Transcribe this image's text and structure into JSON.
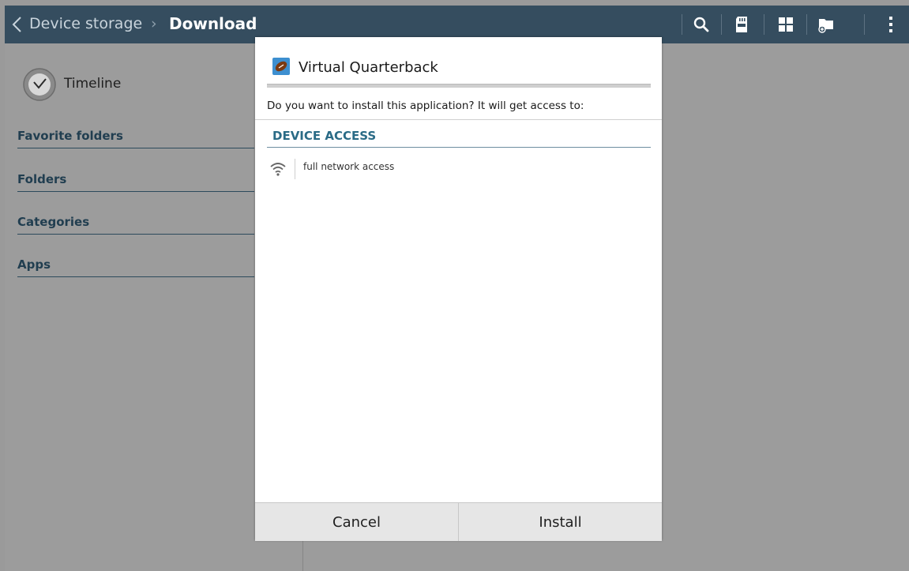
{
  "action_bar": {
    "breadcrumb_root": "Device storage",
    "breadcrumb_separator": "›",
    "breadcrumb_current": "Download",
    "icons": [
      "back-icon",
      "search-icon",
      "sd-card-icon",
      "grid-view-icon",
      "new-folder-icon",
      "overflow-menu-icon"
    ],
    "background": "#354d5f"
  },
  "sidebar": {
    "timeline_label": "Timeline",
    "sections": [
      {
        "label": "Favorite folders"
      },
      {
        "label": "Folders"
      },
      {
        "label": "Categories"
      },
      {
        "label": "Apps"
      }
    ]
  },
  "dialog": {
    "app_name": "Virtual Quarterback",
    "question": "Do you want to install this application? It will get access to:",
    "section_title": "DEVICE ACCESS",
    "permissions": [
      {
        "icon": "wifi-icon",
        "label": "full network access"
      }
    ],
    "cancel_label": "Cancel",
    "install_label": "Install",
    "accent": "#2a6b86"
  }
}
